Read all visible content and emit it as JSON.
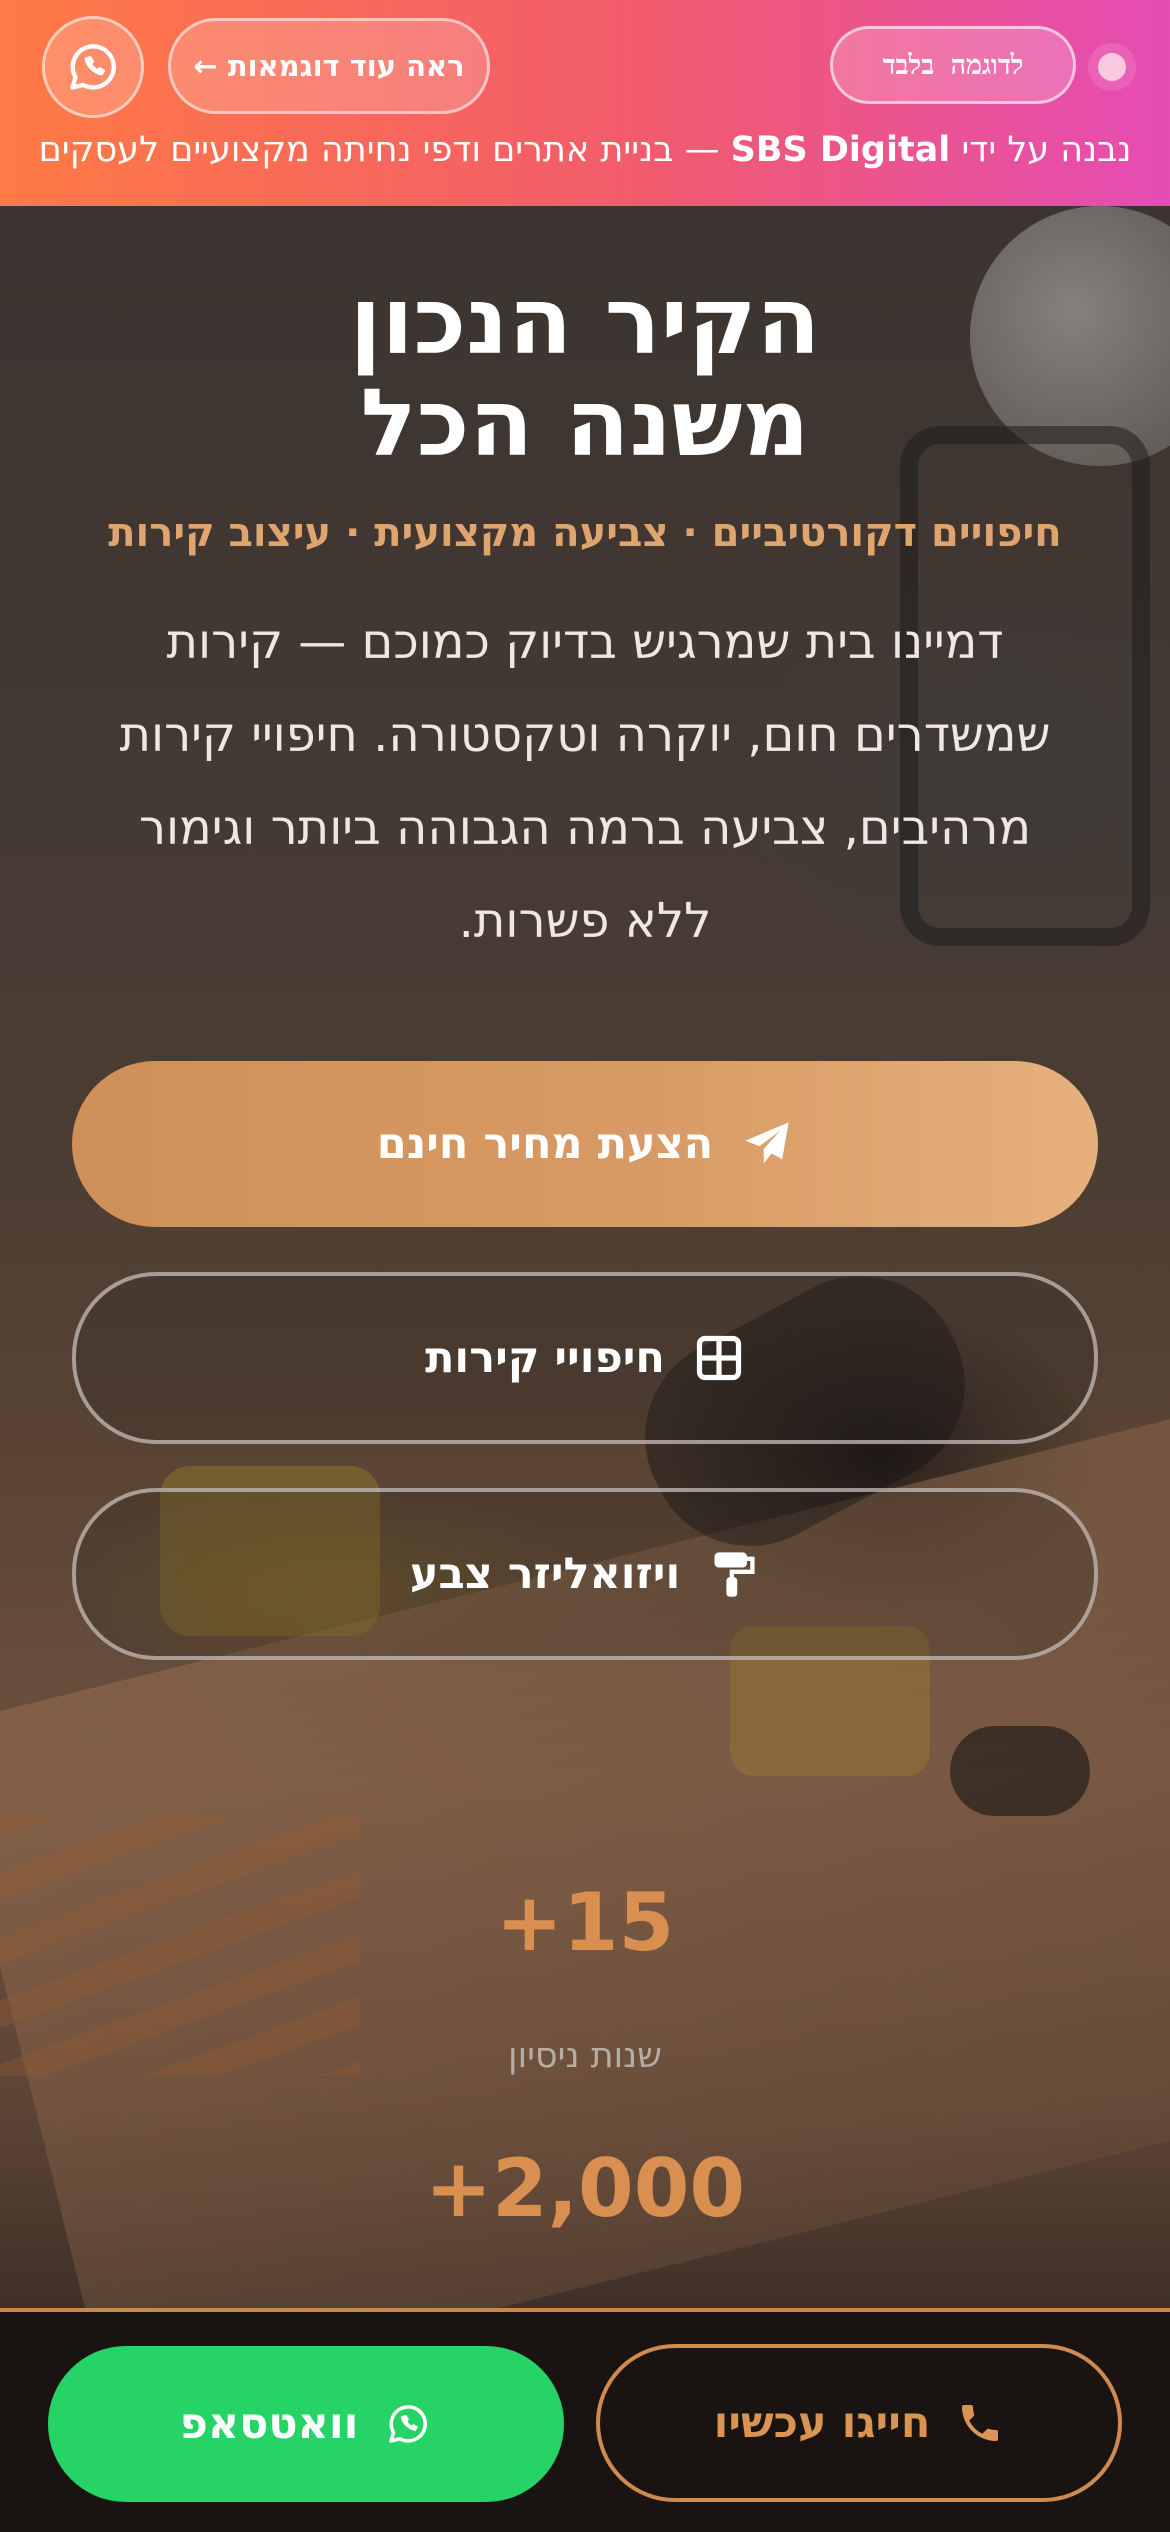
{
  "banner": {
    "more_examples": "ראה עוד דוגמאות ←",
    "demo_label": "לדוגמה בלבד",
    "built_by_prefix": "נבנה על ידי",
    "built_by_brand": "SBS Digital",
    "built_by_suffix": "— בניית אתרים ודפי נחיתה מקצועיים לעסקים",
    "gradient_colors": [
      "#ff7a45",
      "#f15b6c",
      "#e54cb4"
    ]
  },
  "hero": {
    "title_line1": "הקיר הנכון",
    "title_line2": "משנה הכל",
    "subtitle": "חיפויים דקורטיביים · צביעה מקצועית · עיצוב קירות",
    "description": "דמיינו בית שמרגיש בדיוק כמוכם — קירות שמשדרים חום, יוקרה וטקסטורה. חיפויי קירות מרהיבים, צביעה ברמה הגבוהה ביותר וגימור ללא פשרות.",
    "accent_color": "#e0a56e"
  },
  "buttons": {
    "quote_label": "הצעת מחיר חינם",
    "quote_icon": "paper-plane-icon",
    "walls_label": "חיפויי קירות",
    "walls_icon": "grid-icon",
    "visualizer_label": "ויזואליזר צבע",
    "visualizer_icon": "paint-roller-icon"
  },
  "stats": [
    {
      "value": "+15",
      "label": "שנות ניסיון"
    },
    {
      "value": "+2,000"
    }
  ],
  "bottom_bar": {
    "call_label": "חייגו עכשיו",
    "call_icon": "phone-icon",
    "whatsapp_label": "וואטסאפ",
    "whatsapp_icon": "whatsapp-icon",
    "whatsapp_color": "#25d366",
    "call_color": "#d99352"
  }
}
